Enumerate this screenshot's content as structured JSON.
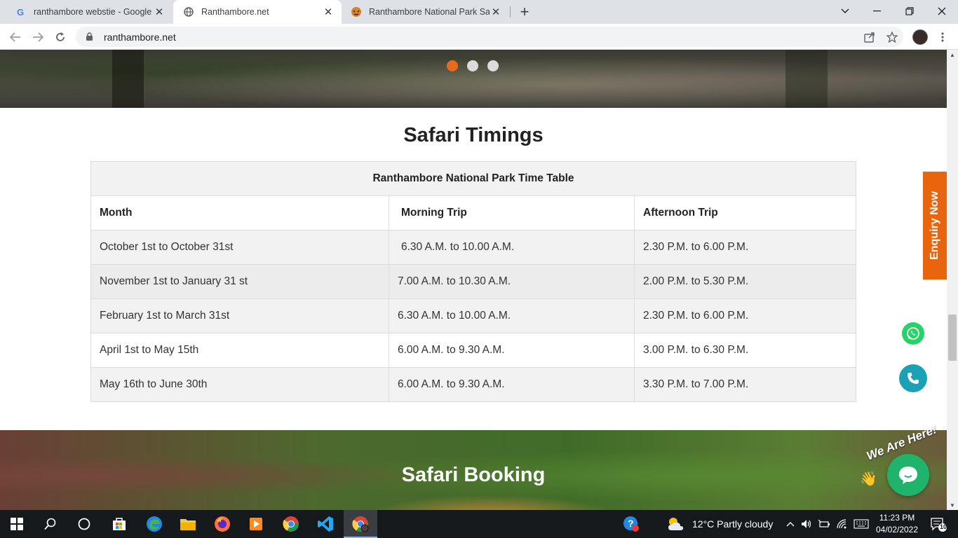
{
  "browser": {
    "tabs": [
      {
        "title": "ranthambore webstie - Google Se",
        "favicon": "google-icon"
      },
      {
        "title": "Ranthambore.net",
        "favicon": "globe-icon"
      },
      {
        "title": "Ranthambore National Park Sawa",
        "favicon": "tiger-icon"
      }
    ],
    "url": "ranthambore.net"
  },
  "page": {
    "section_title": "Safari Timings",
    "table": {
      "caption": "Ranthambore National Park Time Table",
      "headers": [
        "Month",
        "Morning Trip",
        "Afternoon Trip"
      ],
      "rows": [
        [
          "October 1st to October 31st",
          "6.30 A.M. to 10.00 A.M.",
          "2.30 P.M. to 6.00 P.M."
        ],
        [
          "November 1st to January 31 st",
          "7.00 A.M. to 10.30 A.M.",
          "2.00 P.M. to 5.30 P.M."
        ],
        [
          "February 1st to March 31st",
          "6.30 A.M. to 10.00 A.M.",
          "2.30 P.M. to 6.00 P.M."
        ],
        [
          "April 1st to May 15th",
          "6.00 A.M. to 9.30 A.M.",
          "3.00 P.M. to 6.30 P.M."
        ],
        [
          "May 16th to June 30th",
          "6.00 A.M. to 9.30 A.M.",
          "3.30 P.M. to 7.00 P.M."
        ]
      ]
    },
    "booking_title": "Safari Booking",
    "enquiry_label": "Enquiry Now",
    "chat_badge": "We Are Here!",
    "accent_color": "#e8650e"
  },
  "taskbar": {
    "weather": "12°C  Partly cloudy",
    "time": "11:23 PM",
    "date": "04/02/2022",
    "notifications": "10"
  }
}
